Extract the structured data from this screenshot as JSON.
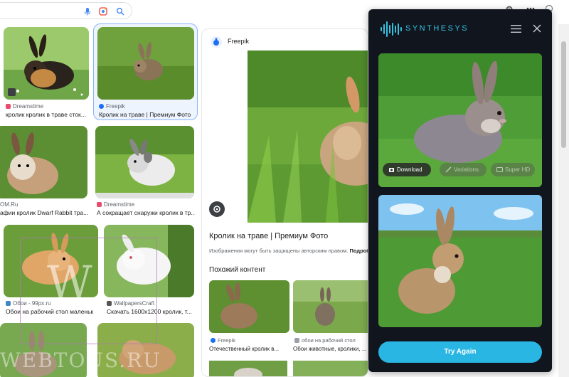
{
  "colors": {
    "accent": "#35c1e0",
    "panel_bg": "#11151e",
    "try_again_bg": "#29b6e3",
    "selected_outline": "#8ab4f8"
  },
  "grid": {
    "cards": [
      {
        "source": "Dreamstime",
        "source_icon": "dreamstime-icon",
        "caption": "кролик кролик в траве сток..."
      },
      {
        "source": "Freepik",
        "source_icon": "freepik-icon",
        "caption": "Кролик на траве | Премиум Фото"
      },
      {
        "source": "OM.Ru",
        "source_icon": "",
        "caption": "афии кролик Dwarf Rabbit тра..."
      },
      {
        "source": "Dreamstime",
        "source_icon": "dreamstime-icon",
        "caption": "А сокращает снаружи кролик в тр..."
      },
      {
        "source": "Обои - 99px.ru",
        "source_icon": "99px-icon",
        "caption": "Обои на рабочий стол маленьк..."
      },
      {
        "source": "WallpapersCraft",
        "source_icon": "wallpaperscraft-icon",
        "caption": "Скачать 1600x1200 кролик, т..."
      }
    ]
  },
  "preview": {
    "source": "Freepik",
    "title": "Кролик на траве | Премиум Фото",
    "note": "Изображения могут быть защищены авторским правом.",
    "note_link": "Подробнее...",
    "similar_heading": "Похожий контент",
    "similar": [
      {
        "source": "Freepik",
        "caption": "Отечественный кролик в..."
      },
      {
        "source": "обои на рабочий стол",
        "caption": "Обои животные, кролики, ..."
      }
    ]
  },
  "synthesys": {
    "brand": "SYNTHESYS",
    "actions": {
      "download": "Download",
      "variations": "Variations",
      "super_hd": "Super HD"
    },
    "try_again": "Try Again"
  },
  "watermark": {
    "letter": "W",
    "text": "WEBTOUS.RU"
  }
}
